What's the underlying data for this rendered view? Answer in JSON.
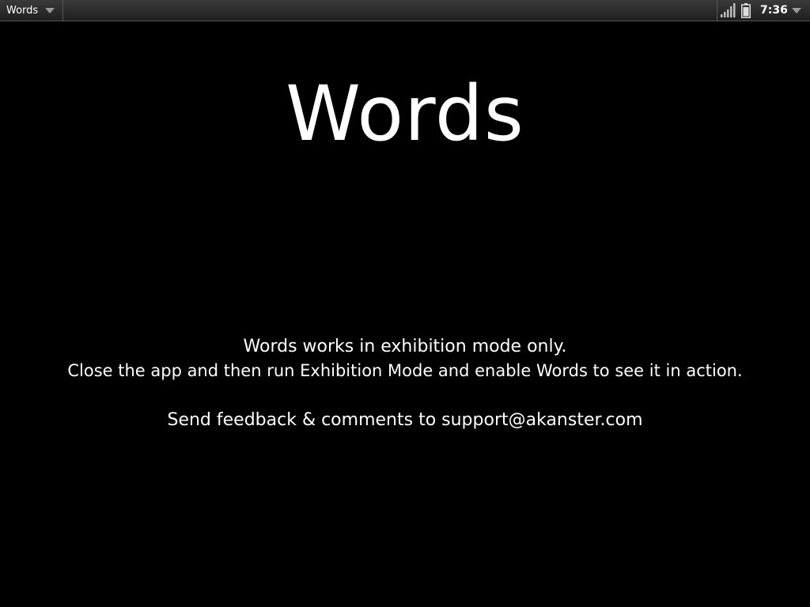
{
  "statusbar": {
    "app_name": "Words",
    "time": "7:36",
    "icons": [
      "chevron-down-icon",
      "signal-icon",
      "battery-icon"
    ]
  },
  "main": {
    "title": "Words",
    "line1": "Words works in exhibition mode only.",
    "line2": "Close the app and then run Exhibition Mode and enable Words to see it in action.",
    "line3": "Send feedback & comments to support@akanster.com"
  },
  "colors": {
    "background": "#000000",
    "text": "#ffffff",
    "statusbar": "#2b2b2b"
  }
}
